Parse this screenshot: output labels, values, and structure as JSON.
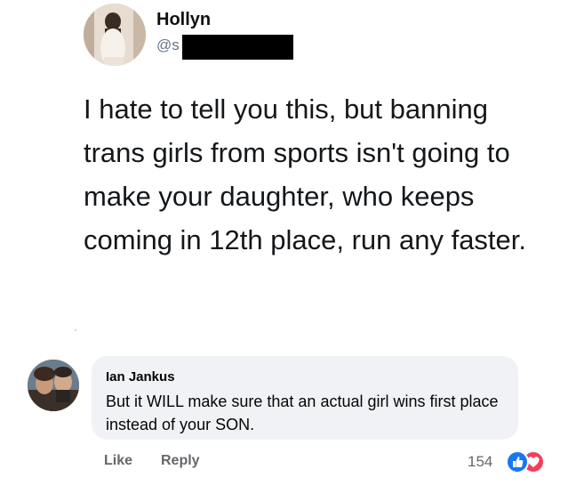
{
  "post": {
    "author_name": "Hollyn",
    "author_handle": "@s",
    "text": "I hate to tell you this, but banning trans girls from sports isn't going to make your daughter, who keeps coming in 12th place, run any faster."
  },
  "comment": {
    "author_name": "Ian Jankus",
    "text": "But it WILL make sure that an actual girl wins first place instead of your SON.",
    "actions": {
      "like_label": "Like",
      "reply_label": "Reply"
    },
    "reaction_count": "154",
    "reactions": [
      "like-icon",
      "love-icon"
    ],
    "colors": {
      "like": "#1877f2",
      "love": "#f33e58"
    }
  }
}
